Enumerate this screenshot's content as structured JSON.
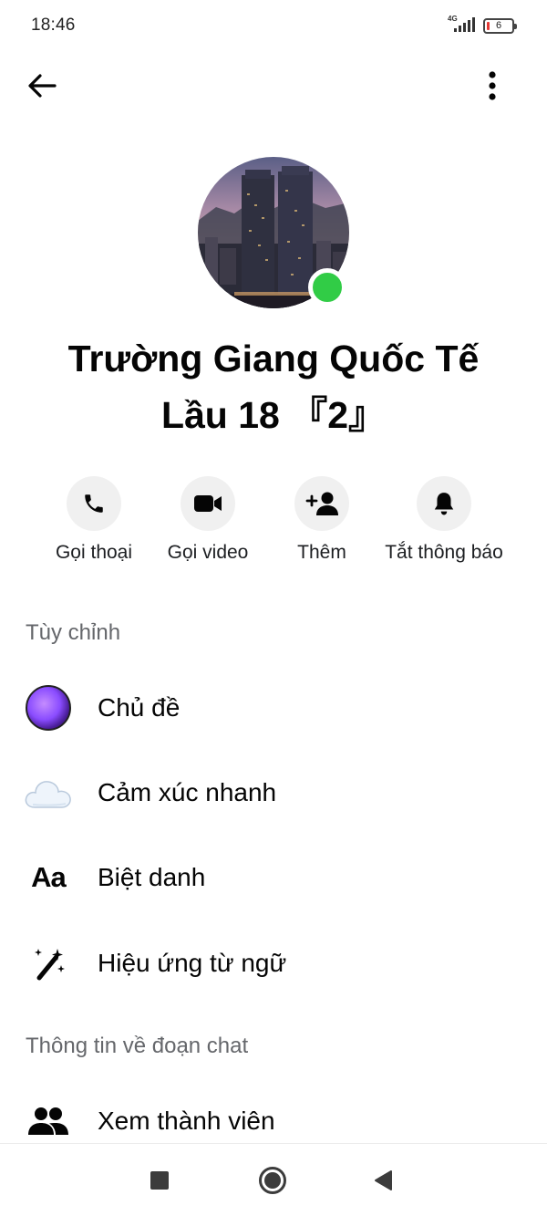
{
  "status_bar": {
    "time": "18:46",
    "network": "4G",
    "battery_level": "6"
  },
  "header": {
    "back_icon": "arrow-left-icon",
    "more_icon": "more-vertical-icon"
  },
  "contact": {
    "name": "Trường Giang Quốc Tế Lầu 18 『2』",
    "online": true,
    "online_color": "#31cc46"
  },
  "actions": [
    {
      "label": "Gọi thoại",
      "icon": "phone-icon"
    },
    {
      "label": "Gọi video",
      "icon": "video-camera-icon"
    },
    {
      "label": "Thêm",
      "icon": "add-person-icon"
    },
    {
      "label": "Tắt thông báo",
      "icon": "bell-icon"
    }
  ],
  "customize": {
    "title": "Tùy chỉnh",
    "items": [
      {
        "label": "Chủ đề",
        "icon": "theme-icon"
      },
      {
        "label": "Cảm xúc nhanh",
        "icon": "cloud-emoji-icon"
      },
      {
        "label": "Biệt danh",
        "icon": "aa-text-icon"
      },
      {
        "label": "Hiệu ứng từ ngữ",
        "icon": "magic-wand-icon"
      }
    ]
  },
  "chat_info": {
    "title": "Thông tin về đoạn chat",
    "items": [
      {
        "label": "Xem thành viên",
        "icon": "people-icon"
      }
    ]
  },
  "nav_bar": {
    "buttons": [
      "recents-square-icon",
      "home-circle-icon",
      "back-triangle-icon"
    ]
  }
}
